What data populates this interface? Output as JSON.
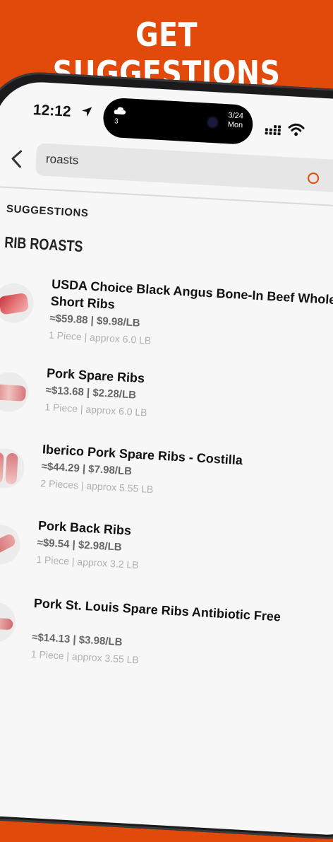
{
  "banner": {
    "headline": "GET SUGGESTIONS"
  },
  "status_bar": {
    "time": "12:12",
    "temp": "3",
    "date_line1": "3/24",
    "date_line2": "Mon"
  },
  "search": {
    "query": "roasts"
  },
  "suggestions": {
    "heading": "SUGGESTIONS",
    "category": "RIB ROASTS",
    "items": [
      {
        "name": "USDA Choice Black Angus Bone-In Beef Whole Rib Short Ribs",
        "price": "≈$59.88 | $9.98/LB",
        "meta": "1 Piece | approx 6.0 LB"
      },
      {
        "name": "Pork Spare Ribs",
        "price": "≈$13.68 | $2.28/LB",
        "meta": "1 Piece | approx 6.0 LB"
      },
      {
        "name": "Iberico Pork Spare Ribs - Costilla",
        "price": "≈$44.29 | $7.98/LB",
        "meta": "2 Pieces | approx 5.55 LB"
      },
      {
        "name": "Pork Back Ribs",
        "price": "≈$9.54 | $2.98/LB",
        "meta": "1 Piece | approx 3.2 LB"
      },
      {
        "name": "Pork St. Louis Spare Ribs Antibiotic Free",
        "price": "≈$14.13 | $3.98/LB",
        "meta": "1 Piece | approx 3.55 LB"
      }
    ]
  },
  "colors": {
    "brand": "#E14A0A",
    "background": "#F7F7F7"
  },
  "icons": [
    "location-arrow-icon",
    "cloud-icon",
    "signal-icon",
    "wifi-icon",
    "back-chevron-icon",
    "clear-search-icon"
  ]
}
